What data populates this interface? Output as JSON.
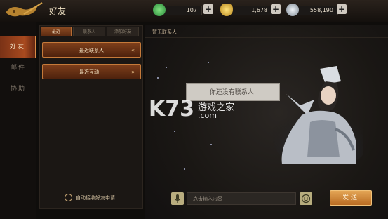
{
  "header": {
    "title": "好友"
  },
  "resources": [
    {
      "name": "jade",
      "value": "107",
      "color": "#3fb34f"
    },
    {
      "name": "gold-ingot",
      "value": "1,678",
      "color": "#e1b43a"
    },
    {
      "name": "silver",
      "value": "558,190",
      "color": "#b8c2cc"
    }
  ],
  "sidebar": {
    "items": [
      {
        "label": "好友"
      },
      {
        "label": "邮件"
      },
      {
        "label": "协助"
      }
    ]
  },
  "friends_panel": {
    "tabs": [
      {
        "label": "最近"
      },
      {
        "label": "联系人"
      },
      {
        "label": "添加好友"
      }
    ],
    "groups": [
      {
        "label": "最近联系人",
        "chevron": "«"
      },
      {
        "label": "最近互动",
        "chevron": "»"
      }
    ],
    "auto_accept_label": "自动接收好友申请"
  },
  "chat": {
    "header": "暂无联系人",
    "empty_message": "你还没有联系人!",
    "input_placeholder": "点击输入内容",
    "send_label": "发送"
  },
  "watermark": {
    "logo": "K73",
    "text": "游戏之家",
    "domain": ".com"
  },
  "colors": {
    "accent": "#a84a1f",
    "send": "#d58c3a"
  }
}
